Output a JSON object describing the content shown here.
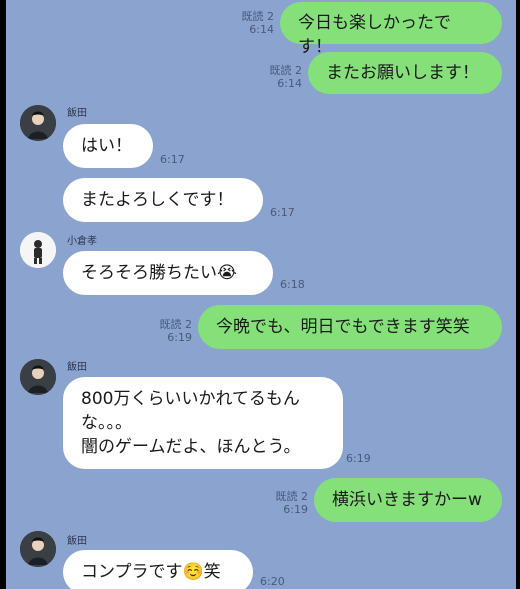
{
  "messages": [
    {
      "text": "今日も楽しかったです！",
      "read": "既読 2",
      "time": "6:14"
    },
    {
      "text": "またお願いします！",
      "read": "既読 2",
      "time": "6:14"
    },
    {
      "sender": "飯田",
      "text": "はい！",
      "time": "6:17"
    },
    {
      "text": "またよろしくです！",
      "time": "6:17"
    },
    {
      "sender": "小倉孝",
      "text": "そろそろ勝ちたい😭",
      "time": "6:18"
    },
    {
      "text": "今晩でも、明日でもできます笑笑",
      "read": "既読 2",
      "time": "6:19"
    },
    {
      "sender": "飯田",
      "text": "800万くらいいかれてるもん\nな。。。\n闇のゲームだよ、ほんとう。",
      "time": "6:19"
    },
    {
      "text": "横浜いきますかーw",
      "read": "既読 2",
      "time": "6:19"
    },
    {
      "sender": "飯田",
      "text": "コンプラです☺️笑",
      "time": "6:20"
    }
  ],
  "colors": {
    "background": "#8aa3cf",
    "outgoing_bubble": "#85e07a",
    "incoming_bubble": "#ffffff"
  },
  "icons": {
    "avatar_iida": "person-avatar-icon",
    "avatar_ogura": "person-avatar-icon"
  }
}
